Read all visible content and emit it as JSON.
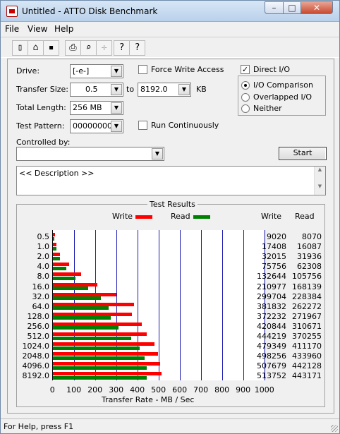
{
  "window": {
    "title": "Untitled - ATTO Disk Benchmark",
    "caption_min": "–",
    "caption_max": "□",
    "caption_close": "✕"
  },
  "menu": [
    "File",
    "View",
    "Help"
  ],
  "toolbar": {
    "icons": [
      "new-icon",
      "open-icon",
      "save-icon",
      "print-icon",
      "print-preview-icon",
      "move-icon",
      "help-icon",
      "context-help-icon"
    ],
    "glyphs": [
      "▯",
      "⌂",
      "▪",
      "⎙",
      "⌕",
      "✛",
      "?",
      "?"
    ]
  },
  "form": {
    "drive_label": "Drive:",
    "drive_value": "[-e-]",
    "transfer_size_label": "Transfer Size:",
    "transfer_from": "0.5",
    "to_label": "to",
    "transfer_to": "8192.0",
    "unit": "KB",
    "total_length_label": "Total Length:",
    "total_length_value": "256 MB",
    "test_pattern_label": "Test Pattern:",
    "test_pattern_value": "00000000",
    "controlled_by_label": "Controlled by:",
    "controlled_by_value": "",
    "force_write_access": "Force Write Access",
    "run_continuously": "Run Continuously",
    "direct_io": "Direct I/O",
    "io_comparison": "I/O Comparison",
    "overlapped_io": "Overlapped I/O",
    "neither": "Neither",
    "start": "Start",
    "description": "<< Description >>",
    "dropdown_glyph": "▼",
    "check_glyph": "✓"
  },
  "chart_data": {
    "type": "bar",
    "title": "Test Results",
    "xlabel": "Transfer Rate - MB / Sec",
    "xlim": [
      0,
      1000
    ],
    "xticks": [
      "0",
      "100",
      "200",
      "300",
      "400",
      "500",
      "600",
      "700",
      "800",
      "900",
      "1000"
    ],
    "categories": [
      "0.5",
      "1.0",
      "2.0",
      "4.0",
      "8.0",
      "16.0",
      "32.0",
      "64.0",
      "128.0",
      "256.0",
      "512.0",
      "1024.0",
      "2048.0",
      "4096.0",
      "8192.0"
    ],
    "series": [
      {
        "name": "Write",
        "color": "#ff0000",
        "values": [
          9,
          17,
          32,
          76,
          133,
          211,
          300,
          382,
          372,
          421,
          444,
          479,
          498,
          508,
          514
        ]
      },
      {
        "name": "Read",
        "color": "#008000",
        "values": [
          8,
          16,
          32,
          62,
          106,
          168,
          228,
          262,
          272,
          311,
          370,
          411,
          434,
          442,
          443
        ]
      }
    ],
    "table_headers": [
      "Write",
      "Read"
    ],
    "write_kb": [
      "9020",
      "17408",
      "32015",
      "75756",
      "132644",
      "210977",
      "299704",
      "381832",
      "372232",
      "420844",
      "444219",
      "479349",
      "498256",
      "507679",
      "513752"
    ],
    "read_kb": [
      "8070",
      "16087",
      "31936",
      "62308",
      "105756",
      "168139",
      "228384",
      "262272",
      "271967",
      "310671",
      "370255",
      "411170",
      "433960",
      "442128",
      "443171"
    ],
    "grid": true,
    "legend": "top"
  },
  "status": "For Help, press F1"
}
